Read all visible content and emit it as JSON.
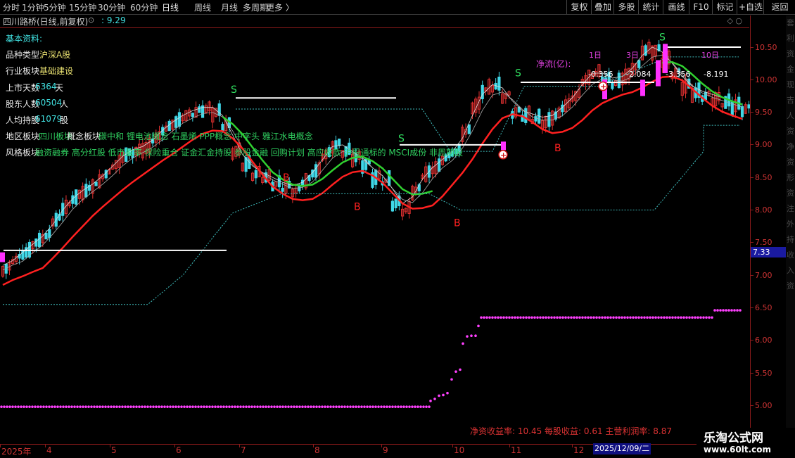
{
  "toolbar": {
    "tabs": [
      "分时",
      "1分钟",
      "5分钟",
      "15分钟",
      "30分钟",
      "60分钟",
      "日线",
      "周线",
      "月线",
      "多周期",
      "更多"
    ],
    "active": "日线",
    "right_buttons": [
      "复权",
      "叠加",
      "多股",
      "统计",
      "画线",
      "F10",
      "标记",
      "+自选",
      "返回"
    ]
  },
  "chart": {
    "title": "四川路桥(日线,前复权)",
    "indicator_value": ": 9.29",
    "current_price": "7.33",
    "price_ticks": [
      "10.50",
      "10.00",
      "9.50",
      "9.00",
      "8.50",
      "8.00",
      "7.50",
      "7.00",
      "6.50",
      "6.00",
      "5.50",
      "5.00"
    ]
  },
  "info_panel": {
    "header": "基本资料:",
    "rows": [
      {
        "label": "品种类型",
        "value": "沪深A股"
      },
      {
        "label": "行业板块",
        "value": "基础建设"
      },
      {
        "label": "上市天数",
        "value": "6364",
        "unit": "天"
      },
      {
        "label": "股东人数",
        "value": "60504",
        "unit": "人"
      },
      {
        "label": "人均持股",
        "value": "61079",
        "unit": "股"
      }
    ],
    "region": {
      "label": "地区板块",
      "value": "四川板块"
    },
    "concept": {
      "label": "概念板块",
      "value": "碳中和 锂电池概念 石墨烯 PPP概念 中字头 雅江水电概念"
    },
    "style": {
      "label": "风格板块",
      "value": "融资融券 高分红股 低市盈率 保险重仓 证金汇金持股 参股金融 回购计划 高应收款 沪股通标的 MSCI成份 非周期股"
    }
  },
  "netflow": {
    "label": "净流(亿):",
    "periods": [
      "1日",
      "3日",
      "10日"
    ],
    "values": [
      "-0.356",
      "-2.084",
      "-3.356",
      "-8.191"
    ]
  },
  "financials": {
    "text": "净资收益率: 10.45 每股收益: 0.61 主营利润率: 8.87"
  },
  "signals": {
    "buy": "B",
    "sell": "S"
  },
  "date_axis": {
    "labels": [
      "2025年",
      "4",
      "5",
      "6",
      "7",
      "8",
      "9",
      "10",
      "11",
      "12"
    ],
    "cursor_date": "2025/12/09/二"
  },
  "side_strip_text": [
    "套",
    "利",
    "资",
    "金",
    "现",
    "吉",
    "人",
    "资",
    "净",
    "资",
    "形",
    "资",
    "注",
    "外",
    "持",
    "收",
    "入",
    "资"
  ],
  "watermark": {
    "title": "乐淘公式网",
    "url": "www.60lt.com"
  },
  "chart_data": {
    "type": "line",
    "title": "",
    "ylim": [
      4.8,
      10.8
    ],
    "series": [
      {
        "name": "",
        "values": [
          7.1,
          7.25,
          7.35,
          7.5,
          7.6,
          7.85,
          8.05,
          8.2,
          8.3,
          8.4,
          8.55,
          8.7,
          8.85,
          8.9,
          8.95,
          9.1,
          9.25,
          9.35,
          9.45,
          9.5,
          9.55,
          9.5,
          9.3,
          8.9,
          8.7,
          8.55,
          8.5,
          8.4,
          8.35,
          8.3,
          8.45,
          8.6,
          8.85,
          9.0,
          8.9,
          8.8,
          8.7,
          8.5,
          8.45,
          8.1,
          8.0,
          8.3,
          8.55,
          8.65,
          8.8,
          8.9,
          9.2,
          9.6,
          9.85,
          9.9,
          9.75,
          9.5,
          9.45,
          9.4,
          9.35,
          9.45,
          9.6,
          9.75,
          10.0,
          10.1,
          10.0,
          9.95,
          10.05,
          10.2,
          10.45,
          10.45,
          10.3,
          10.1,
          9.9,
          9.8,
          9.75,
          9.7,
          9.65,
          9.6,
          9.55
        ]
      }
    ]
  }
}
